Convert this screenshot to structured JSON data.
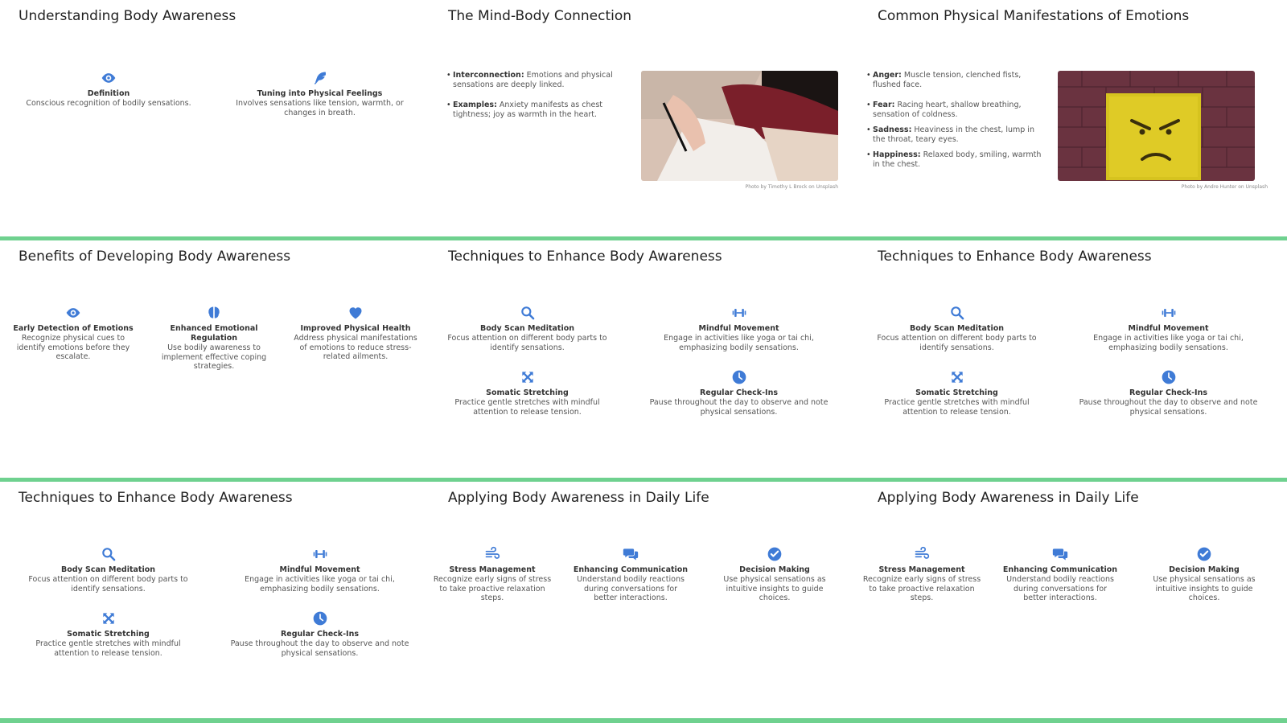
{
  "colors": {
    "accent": "#3f7bd6",
    "divider": "#6fd18f"
  },
  "slides": {
    "s1": {
      "title": "Understanding Body Awareness",
      "items": [
        {
          "icon": "eye-icon",
          "heading": "Definition",
          "desc": "Conscious recognition of bodily sensations."
        },
        {
          "icon": "feather-icon",
          "heading": "Tuning into Physical Feelings",
          "desc": "Involves sensations like tension, warmth, or changes in breath."
        }
      ]
    },
    "s2": {
      "title": "The Mind-Body Connection",
      "bullets": [
        {
          "label": "Interconnection:",
          "text": " Emotions and physical sensations are deeply linked."
        },
        {
          "label": "Examples:",
          "text": " Anxiety manifests as chest tightness; joy as warmth in the heart."
        }
      ],
      "credit": "Photo by Timothy L Brock on Unsplash"
    },
    "s3": {
      "title": "Common Physical Manifestations of Emotions",
      "bullets": [
        {
          "label": "Anger:",
          "text": " Muscle tension, clenched fists, flushed face."
        },
        {
          "label": "Fear:",
          "text": " Racing heart, shallow breathing, sensation of coldness."
        },
        {
          "label": "Sadness:",
          "text": " Heaviness in the chest, lump in the throat, teary eyes."
        },
        {
          "label": "Happiness:",
          "text": " Relaxed body, smiling, warmth in the chest."
        }
      ],
      "credit": "Photo by Andre Hunter on Unsplash"
    },
    "s4": {
      "title": "Benefits of Developing Body Awareness",
      "items": [
        {
          "icon": "eye-icon",
          "heading": "Early Detection of Emotions",
          "desc": "Recognize physical cues to identify emotions before they escalate."
        },
        {
          "icon": "brain-icon",
          "heading": "Enhanced Emotional Regulation",
          "desc": "Use bodily awareness to implement effective coping strategies."
        },
        {
          "icon": "heart-icon",
          "heading": "Improved Physical Health",
          "desc": "Address physical manifestations of emotions to reduce stress-related ailments."
        }
      ]
    },
    "techniques": {
      "title": "Techniques to Enhance Body Awareness",
      "items": [
        {
          "icon": "search-icon",
          "heading": "Body Scan Meditation",
          "desc": "Focus attention on different body parts to identify sensations."
        },
        {
          "icon": "dumbbell-icon",
          "heading": "Mindful Movement",
          "desc": "Engage in activities like yoga or tai chi, emphasizing bodily sensations."
        },
        {
          "icon": "expand-icon",
          "heading": "Somatic Stretching",
          "desc": "Practice gentle stretches with mindful attention to release tension."
        },
        {
          "icon": "clock-icon",
          "heading": "Regular Check-Ins",
          "desc": "Pause throughout the day to observe and note physical sensations."
        }
      ]
    },
    "daily": {
      "title": "Applying Body Awareness in Daily Life",
      "items": [
        {
          "icon": "wind-icon",
          "heading": "Stress Management",
          "desc": "Recognize early signs of stress to take proactive relaxation steps."
        },
        {
          "icon": "comments-icon",
          "heading": "Enhancing Communication",
          "desc": "Understand bodily reactions during conversations for better interactions."
        },
        {
          "icon": "check-circle-icon",
          "heading": "Decision Making",
          "desc": "Use physical sensations as intuitive insights to guide choices."
        }
      ]
    }
  }
}
